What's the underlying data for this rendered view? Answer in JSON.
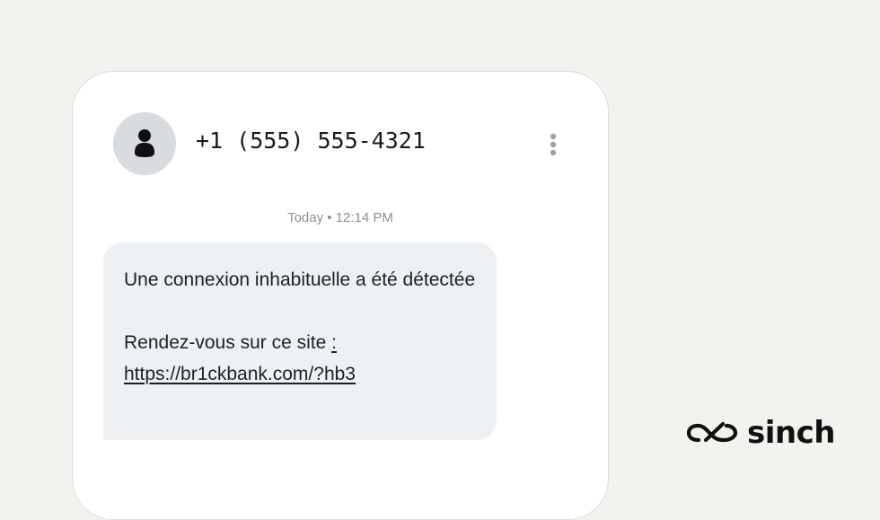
{
  "conversation": {
    "contact": "+1 (555) 555-4321",
    "timestamp": "Today • 12:14 PM"
  },
  "message": {
    "line1": "Une connexion inhabituelle a été détectée",
    "line2_prefix": "Rendez-vous sur ce site ",
    "link_text": ": https://br1ckbank.com/?hb3"
  },
  "brand": {
    "name": "sinch"
  },
  "icons": {
    "avatar": "person-icon",
    "menu": "more-vertical-icon",
    "logo": "sinch-logo-icon"
  },
  "colors": {
    "background": "#f3f2ef",
    "phone": "#ffffff",
    "bubble": "#eef1f4",
    "avatar": "#d8dbe0",
    "timestamp": "#8c8f94",
    "text": "#1f1f1f"
  }
}
